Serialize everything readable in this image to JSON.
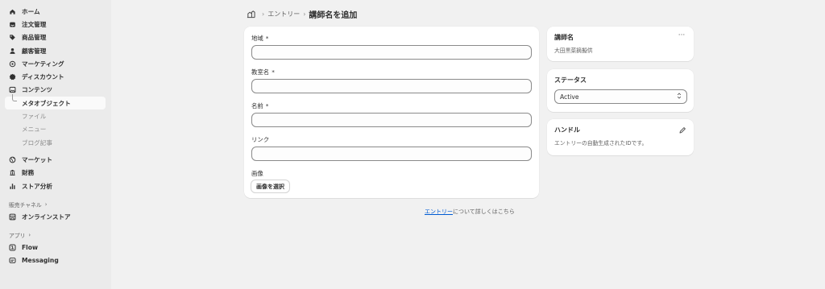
{
  "sidebar": {
    "items": [
      {
        "label": "ホーム",
        "icon": "home-icon"
      },
      {
        "label": "注文管理",
        "icon": "inbox-icon"
      },
      {
        "label": "商品管理",
        "icon": "tag-icon"
      },
      {
        "label": "顧客管理",
        "icon": "person-icon"
      },
      {
        "label": "マーケティング",
        "icon": "target-icon"
      },
      {
        "label": "ディスカウント",
        "icon": "discount-icon"
      },
      {
        "label": "コンテンツ",
        "icon": "image-icon"
      }
    ],
    "content_sub": [
      {
        "label": "メタオブジェクト",
        "active": true
      },
      {
        "label": "ファイル",
        "active": false
      },
      {
        "label": "メニュー",
        "active": false
      },
      {
        "label": "ブログ記事",
        "active": false
      }
    ],
    "items2": [
      {
        "label": "マーケット",
        "icon": "globe-icon"
      },
      {
        "label": "財務",
        "icon": "bank-icon"
      },
      {
        "label": "ストア分析",
        "icon": "bar-chart-icon"
      }
    ],
    "sales_channels_label": "販売チャネル",
    "channels": [
      {
        "label": "オンラインストア",
        "icon": "store-icon"
      }
    ],
    "apps_label": "アプリ",
    "apps": [
      {
        "label": "Flow",
        "icon": "flow-icon"
      },
      {
        "label": "Messaging",
        "icon": "messaging-icon"
      }
    ]
  },
  "breadcrumb": {
    "icon": "metaobject-icon",
    "parent": "エントリー",
    "title": "講師名を追加"
  },
  "form": {
    "fields": [
      {
        "label": "地域",
        "required": true,
        "value": ""
      },
      {
        "label": "教室名",
        "required": true,
        "value": ""
      },
      {
        "label": "名前",
        "required": true,
        "value": ""
      },
      {
        "label": "リンク",
        "required": false,
        "value": ""
      }
    ],
    "required_marker": "*",
    "image_label": "画像",
    "image_button": "画像を選択"
  },
  "instructor_card": {
    "title": "講師名",
    "subtitle": "大田黒菜摘擬供",
    "more_label": "···"
  },
  "status_card": {
    "title": "ステータス",
    "selected": "Active"
  },
  "handle_card": {
    "title": "ハンドル",
    "description": "エントリーの自動生成されたIDです。"
  },
  "footer": {
    "link": "エントリー",
    "text": "について詳しくはこちら"
  },
  "colors": {
    "background": "#f1f1f1",
    "sidebar": "#ebebeb",
    "card": "#ffffff",
    "link": "#005bd3"
  }
}
